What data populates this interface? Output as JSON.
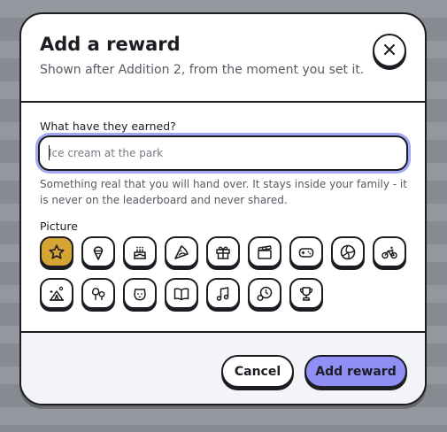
{
  "dialog": {
    "title": "Add a reward",
    "subtitle": "Shown after Addition 2, from the moment you set it."
  },
  "form": {
    "field_label": "What have they earned?",
    "input_value": "",
    "input_placeholder": "Ice cream at the park",
    "help_text": "Something real that you will hand over. It stays inside your family - it is never on the leaderboard and never shared.",
    "picture_label": "Picture",
    "icons": [
      {
        "name": "star-icon",
        "selected": true
      },
      {
        "name": "ice-cream-icon",
        "selected": false
      },
      {
        "name": "cake-icon",
        "selected": false
      },
      {
        "name": "pizza-icon",
        "selected": false
      },
      {
        "name": "gift-icon",
        "selected": false
      },
      {
        "name": "clapperboard-icon",
        "selected": false
      },
      {
        "name": "gamepad-icon",
        "selected": false
      },
      {
        "name": "ball-icon",
        "selected": false
      },
      {
        "name": "bike-icon",
        "selected": false
      },
      {
        "name": "tent-icon",
        "selected": false
      },
      {
        "name": "trees-icon",
        "selected": false
      },
      {
        "name": "pet-icon",
        "selected": false
      },
      {
        "name": "book-icon",
        "selected": false
      },
      {
        "name": "music-icon",
        "selected": false
      },
      {
        "name": "clock-icon",
        "selected": false
      },
      {
        "name": "trophy-icon",
        "selected": false
      }
    ]
  },
  "footer": {
    "cancel_label": "Cancel",
    "add_label": "Add reward"
  },
  "colors": {
    "selected_icon": "#d6a433",
    "primary_button": "#8e90f5",
    "input_focus_ring": "#a3a8f5",
    "outline": "#1c1c22"
  }
}
